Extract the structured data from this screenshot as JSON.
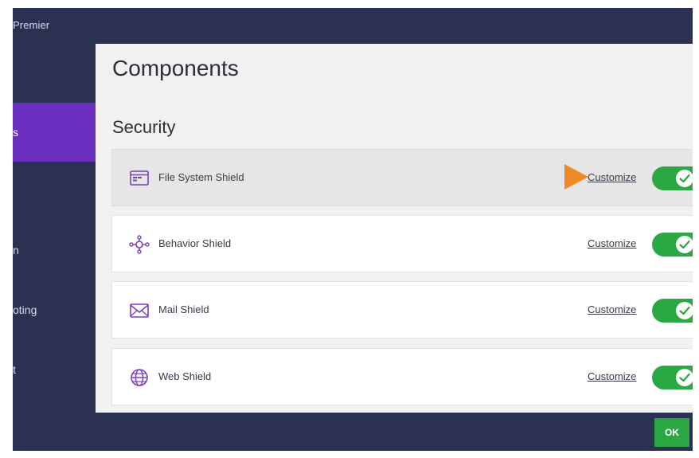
{
  "app": {
    "title": "Premier"
  },
  "sidebar": {
    "items": [
      {
        "label": "s",
        "active": true
      },
      {
        "label": "n",
        "active": false
      },
      {
        "label": "oting",
        "active": false
      },
      {
        "label": "t",
        "active": false
      }
    ]
  },
  "panel": {
    "title": "Components",
    "section": "Security",
    "rows": [
      {
        "icon": "window-icon",
        "label": "File System Shield",
        "link": "Customize",
        "enabled": true,
        "highlighted": true
      },
      {
        "icon": "behavior-icon",
        "label": "Behavior Shield",
        "link": "Customize",
        "enabled": true,
        "highlighted": false
      },
      {
        "icon": "mail-icon",
        "label": "Mail Shield",
        "link": "Customize",
        "enabled": true,
        "highlighted": false
      },
      {
        "icon": "globe-icon",
        "label": "Web Shield",
        "link": "Customize",
        "enabled": true,
        "highlighted": false
      }
    ]
  },
  "footer": {
    "ok_label": "OK"
  },
  "colors": {
    "sidebar_bg": "#2b3150",
    "accent_purple": "#6a2fbe",
    "toggle_green": "#2aa843",
    "arrow_orange": "#f08a24",
    "icon_purple": "#7b3fbf"
  }
}
